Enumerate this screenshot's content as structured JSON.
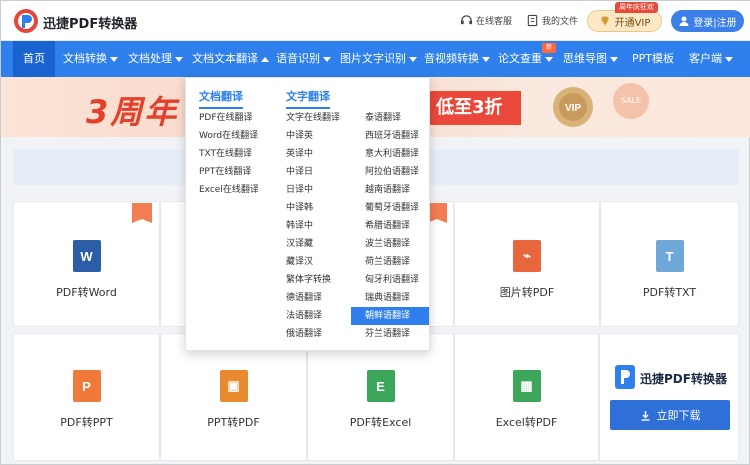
{
  "header": {
    "brand": "迅捷PDF转换器",
    "service": "在线客服",
    "files": "我的文件",
    "vip_label": "开通VIP",
    "vip_tag": "周年庆狂欢",
    "login": "登录|注册"
  },
  "nav": {
    "items": [
      "首页",
      "文档转换",
      "文档处理",
      "文档文本翻译",
      "语音识别",
      "图片文字识别",
      "音视频转换",
      "论文查重",
      "思维导图",
      "PPT模板",
      "客户端"
    ],
    "new_badge": "新"
  },
  "banner": {
    "left_text": "3周年",
    "right_text": "低至3折",
    "vip_text": "VIP",
    "sale_text": "SALE"
  },
  "cards_row1": [
    "PDF转Word",
    "",
    "",
    "图片转PDF",
    "PDF转TXT"
  ],
  "cards_row2": [
    "PDF转PPT",
    "PPT转PDF",
    "PDF转Excel",
    "Excel转PDF"
  ],
  "card_icons": {
    "row1": [
      {
        "letter": "W",
        "color": "#2b5ea7"
      },
      null,
      null,
      {
        "letter": "⌁",
        "color": "#e8663e"
      },
      {
        "letter": "T",
        "color": "#6fa7d8"
      }
    ],
    "row2": [
      {
        "letter": "P",
        "color": "#ef7a3c"
      },
      {
        "letter": "▣",
        "color": "#e88b2f"
      },
      {
        "letter": "E",
        "color": "#3ca75a"
      },
      {
        "letter": "▦",
        "color": "#3ca75a"
      }
    ]
  },
  "promo": {
    "title": "迅捷PDF转换器",
    "download": "立即下载"
  },
  "dropdown": {
    "doc_title": "文档翻译",
    "text_title": "文字翻译",
    "doc_items": [
      "PDF在线翻译",
      "Word在线翻译",
      "TXT在线翻译",
      "PPT在线翻译",
      "Excel在线翻译"
    ],
    "text_col1": [
      "文字在线翻译",
      "中译英",
      "英译中",
      "中译日",
      "日译中",
      "中译韩",
      "韩译中",
      "汉译藏",
      "藏译汉",
      "繁体字转换",
      "德语翻译",
      "法语翻译",
      "俄语翻译"
    ],
    "text_col2": [
      "泰语翻译",
      "西班牙语翻译",
      "意大利语翻译",
      "阿拉伯语翻译",
      "越南语翻译",
      "葡萄牙语翻译",
      "希腊语翻译",
      "波兰语翻译",
      "荷兰语翻译",
      "匈牙利语翻译",
      "瑞典语翻译",
      "朝鲜语翻译",
      "芬兰语翻译"
    ],
    "selected": "朝鲜语翻译"
  },
  "colors": {
    "primary": "#2f80ed",
    "nav_active": "#1963d1",
    "accent_red": "#e9483b"
  }
}
